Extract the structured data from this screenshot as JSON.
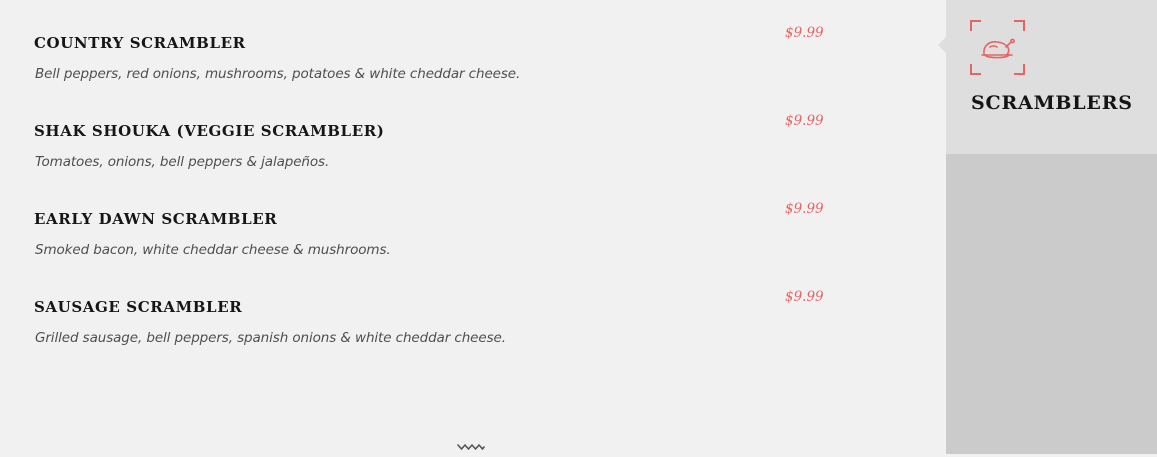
{
  "menu": {
    "items": [
      {
        "name": "COUNTRY SCRAMBLER",
        "description": "Bell peppers, red onions, mushrooms, potatoes & white cheddar cheese.",
        "price": "$9.99"
      },
      {
        "name": "SHAK SHOUKA (VEGGIE SCRAMBLER)",
        "description": "Tomatoes, onions, bell peppers & jalapeños.",
        "price": "$9.99"
      },
      {
        "name": "EARLY DAWN SCRAMBLER",
        "description": "Smoked bacon, white cheddar cheese & mushrooms.",
        "price": "$9.99"
      },
      {
        "name": "SAUSAGE SCRAMBLER",
        "description": "Grilled sausage, bell peppers, spanish onions & white cheddar cheese.",
        "price": "$9.99"
      }
    ]
  },
  "sidebar": {
    "category": {
      "label": "SCRAMBLERS",
      "icon": "roast-chicken-icon"
    }
  },
  "colors": {
    "accent": "#e46565",
    "page_background": "#f1f1f1",
    "active_tab_background": "#dedede",
    "sidebar_background": "#cbcbcb",
    "heading_text": "#161616",
    "description_text": "#4f4f4f"
  },
  "icons": {
    "scroll_indicator": "zigzag-arrow-icon"
  }
}
